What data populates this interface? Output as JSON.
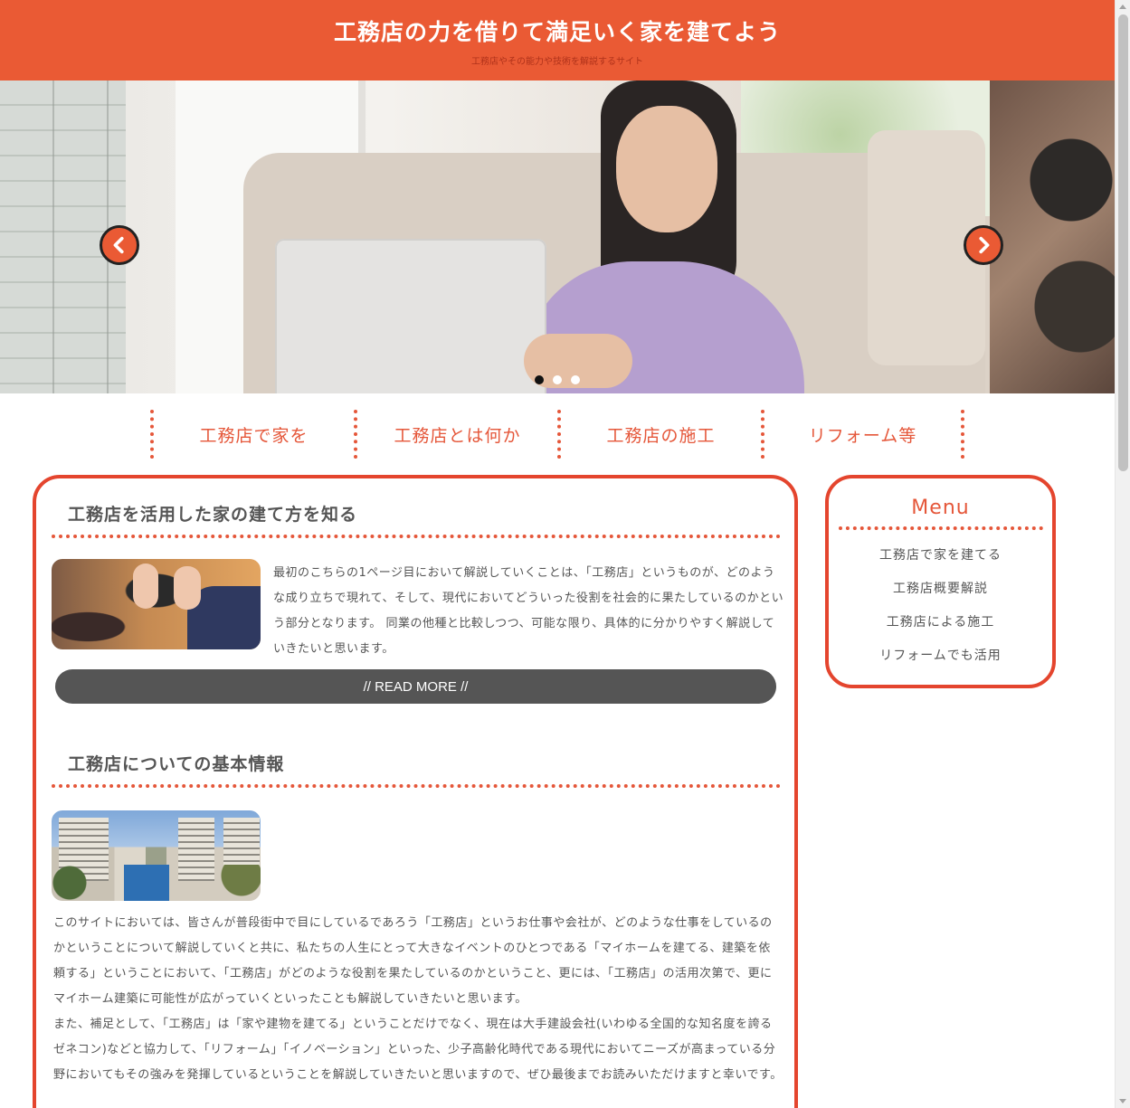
{
  "header": {
    "title": "工務店の力を借りて満足いく家を建てよう",
    "subtitle": "工務店やその能力や技術を解説するサイト",
    "background_color": "#ea5a34"
  },
  "slider": {
    "prev_icon": "chevron-left-icon",
    "next_icon": "chevron-right-icon",
    "slide_count": 3,
    "active_slide": 1
  },
  "nav": {
    "items": [
      {
        "label": "工務店で家を"
      },
      {
        "label": "工務店とは何か"
      },
      {
        "label": "工務店の施工"
      },
      {
        "label": "リフォーム等"
      }
    ]
  },
  "main": {
    "sections": [
      {
        "heading": "工務店を活用した家の建て方を知る",
        "text": "最初のこちらの1ページ目において解説していくことは、「工務店」というものが、どのような成り立ちで現れて、そして、現代においてどういった役割を社会的に果たしているのかという部分となります。 同業の他種と比較しつつ、可能な限り、具体的に分かりやすく解説していきたいと思います。",
        "read_more": "// READ MORE //"
      },
      {
        "heading": "工務店についての基本情報",
        "text_1": "このサイトにおいては、皆さんが普段街中で目にしているであろう「工務店」というお仕事や会社が、どのような仕事をしているのかということについて解説していくと共に、私たちの人生にとって大きなイベントのひとつである「マイホームを建てる、建築を依頼する」ということにおいて、「工務店」がどのような役割を果たしているのかということ、更には、「工務店」の活用次第で、更にマイホーム建築に可能性が広がっていくといったことも解説していきたいと思います。",
        "text_2": "また、補足として、「工務店」は「家や建物を建てる」ということだけでなく、現在は大手建設会社(いわゆる全国的な知名度を誇るゼネコン)などと協力して、「リフォーム」「イノベーション」といった、少子高齢化時代である現代においてニーズが高まっている分野においてもその強みを発揮しているということを解説していきたいと思いますので、ぜひ最後までお読みいただけますと幸いです。"
      }
    ]
  },
  "sidebar": {
    "title": "Menu",
    "items": [
      {
        "label": "工務店で家を建てる"
      },
      {
        "label": "工務店概要解説"
      },
      {
        "label": "工務店による施工"
      },
      {
        "label": "リフォームでも活用"
      }
    ]
  },
  "colors": {
    "accent": "#e5573a",
    "border": "#e4452e",
    "button": "#555555"
  }
}
